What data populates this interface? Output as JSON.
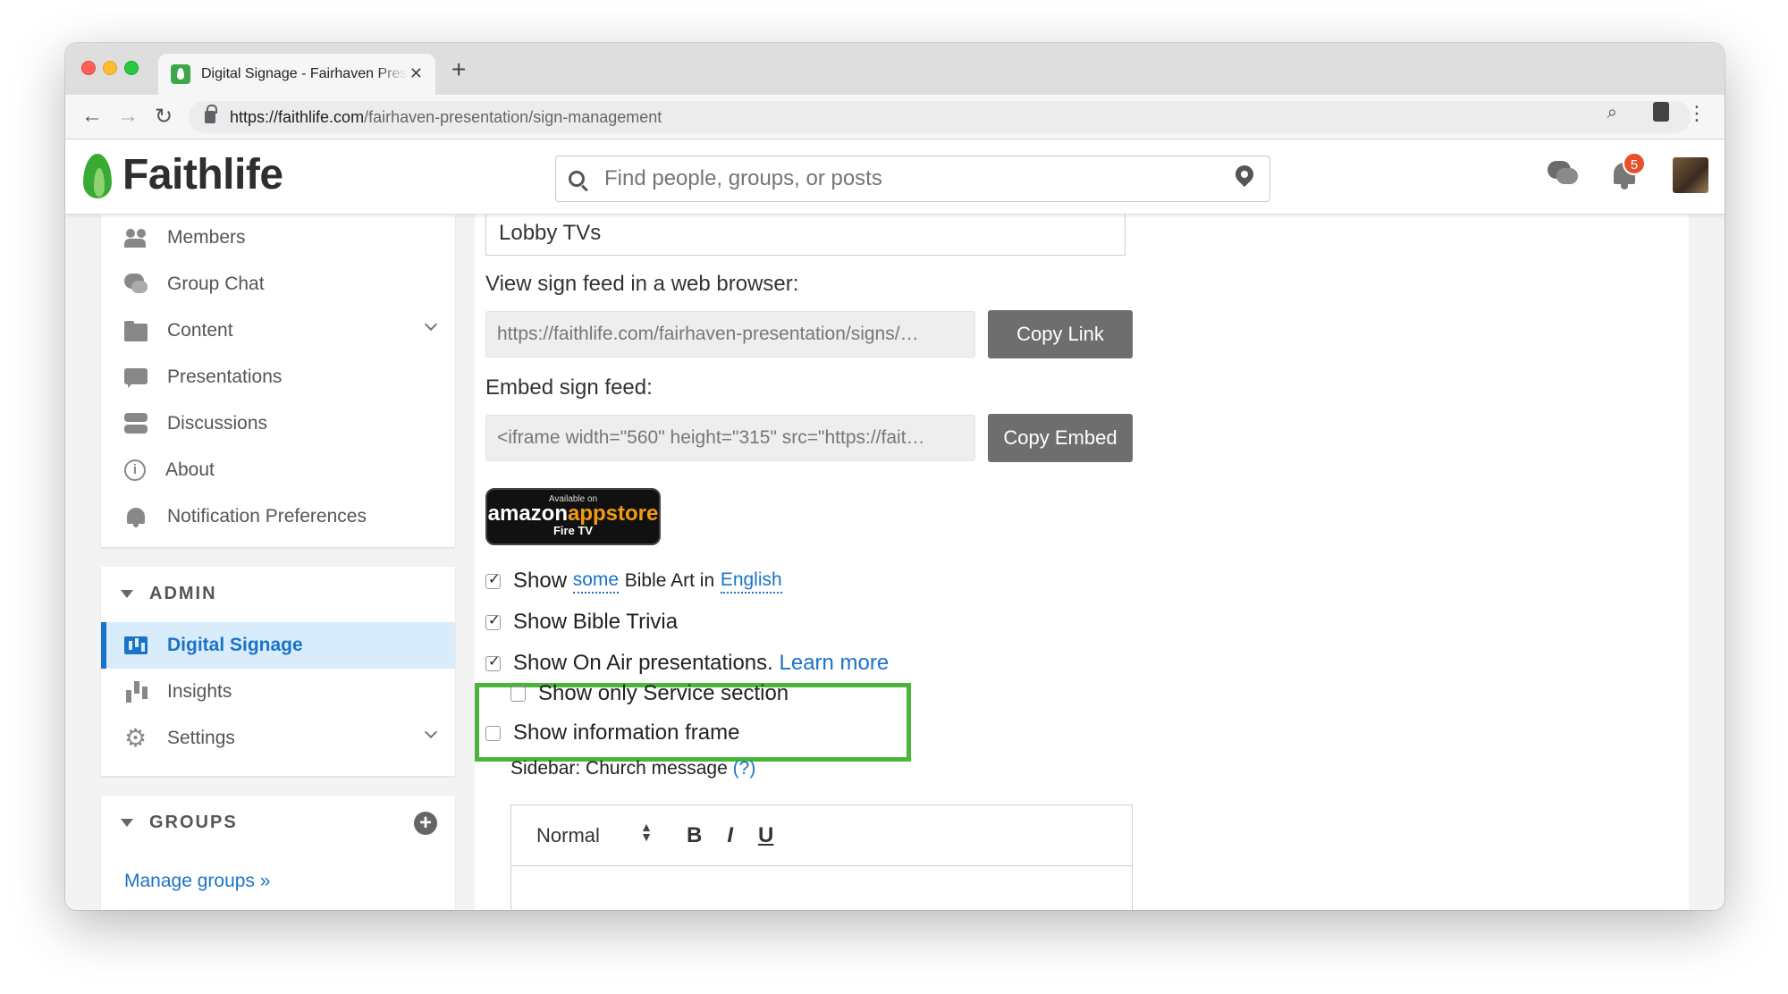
{
  "browser": {
    "tab_title": "Digital Signage - Fairhaven Presentation",
    "url_host": "https://faithlife.com",
    "url_path": "/fairhaven-presentation/sign-management"
  },
  "header": {
    "logo_text": "Faithlife",
    "search_placeholder": "Find people, groups, or posts",
    "notification_count": "5"
  },
  "sidebar": {
    "nav_items": [
      {
        "label": "Members"
      },
      {
        "label": "Group Chat"
      },
      {
        "label": "Content"
      },
      {
        "label": "Presentations"
      },
      {
        "label": "Discussions"
      },
      {
        "label": "About"
      },
      {
        "label": "Notification Preferences"
      }
    ],
    "admin_title": "ADMIN",
    "admin_items": [
      {
        "label": "Digital Signage"
      },
      {
        "label": "Insights"
      },
      {
        "label": "Settings"
      }
    ],
    "groups_title": "GROUPS",
    "manage_groups": "Manage groups »"
  },
  "main": {
    "sign_name": "Lobby TVs",
    "view_feed_label": "View sign feed in a web browser:",
    "feed_url": "https://faithlife.com/fairhaven-presentation/signs/…",
    "copy_link": "Copy Link",
    "embed_label": "Embed sign feed:",
    "embed_code": "<iframe width=\"560\" height=\"315\" src=\"https://fait…",
    "copy_embed": "Copy Embed",
    "amazon_badge": {
      "available": "Available on",
      "brand_a": "amazon",
      "brand_b": "appstore",
      "device": "Fire TV"
    },
    "options": {
      "bible_art": {
        "show": "Show",
        "amount": "some",
        "middle": "Bible Art in",
        "language": "English",
        "checked": true
      },
      "trivia": {
        "label": "Show Bible Trivia",
        "checked": true
      },
      "on_air": {
        "label": "Show On Air presentations.",
        "link": "Learn more",
        "checked": true
      },
      "service_only": {
        "label": "Show only Service section",
        "checked": false
      },
      "info_frame": {
        "label": "Show information frame",
        "checked": false
      }
    },
    "sidebar_message_label": "Sidebar: Church message",
    "help_link": "(?)",
    "editor": {
      "format": "Normal",
      "bold": "B",
      "italic": "I",
      "underline": "U"
    }
  }
}
